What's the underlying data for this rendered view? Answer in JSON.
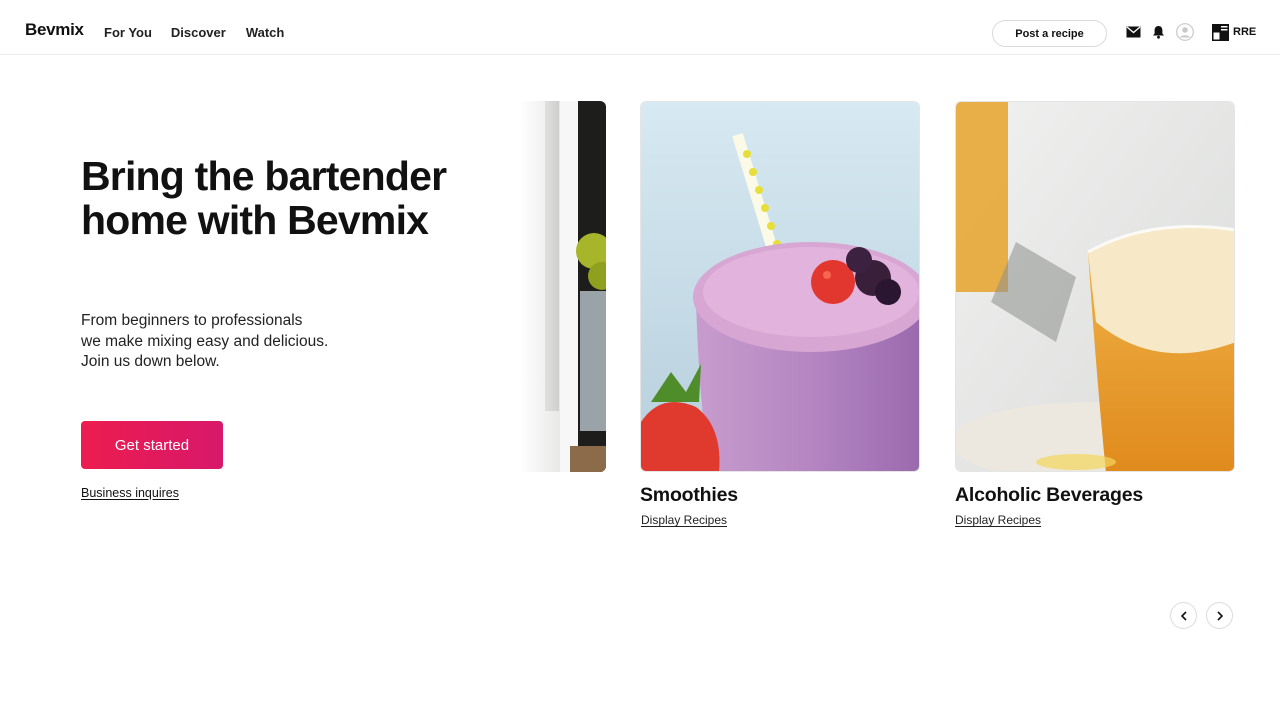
{
  "header": {
    "logo": "Bevmix",
    "nav": [
      "For You",
      "Discover",
      "Watch"
    ],
    "post_recipe_label": "Post a recipe",
    "icons": [
      "mail-icon",
      "bell-icon",
      "user-avatar-icon",
      "flag-icon"
    ],
    "locale": "RRE"
  },
  "hero": {
    "title": "Bring the bartender home with Bevmix",
    "subtitle_lines": [
      "From beginners to professionals",
      "we make mixing easy  and delicious.",
      "Join us down below."
    ],
    "cta_label": "Get started",
    "secondary_link": "Business inquires"
  },
  "carousel": {
    "cards": [
      {
        "title": "Smoothies",
        "link": "Display Recipes"
      },
      {
        "title": "Alcoholic Beverages",
        "link": "Display Recipes"
      }
    ],
    "prev_icon": "chevron-left-icon",
    "next_icon": "chevron-right-icon"
  },
  "colors": {
    "accent": "#e81d58",
    "text": "#111111",
    "border": "#dcdcdc"
  }
}
